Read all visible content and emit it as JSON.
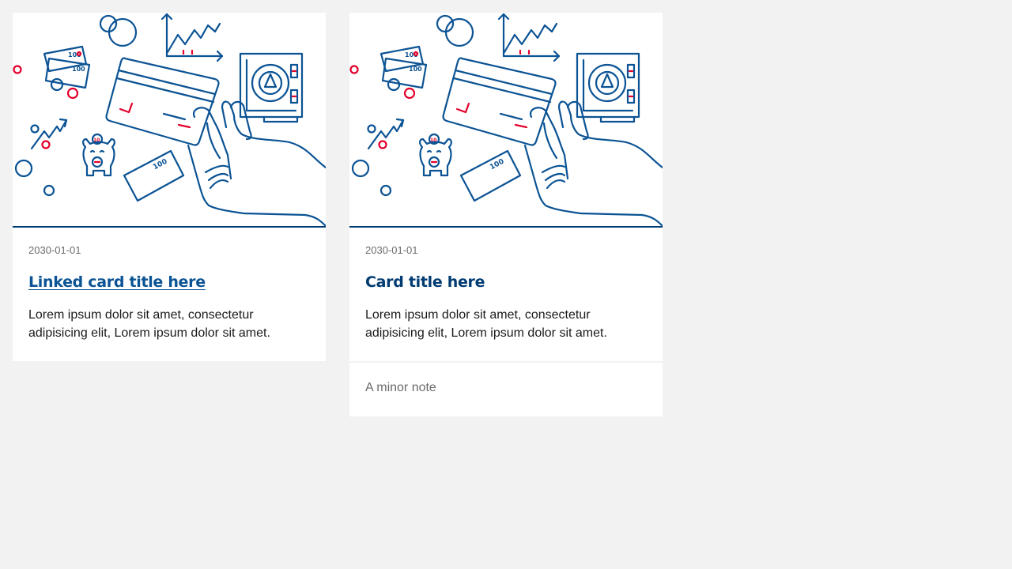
{
  "cards": [
    {
      "date": "2030-01-01",
      "title": "Linked card title here",
      "linked": true,
      "text": "Lorem ipsum dolor sit amet, consectetur adipisicing elit, Lorem ipsum dolor sit amet."
    },
    {
      "date": "2030-01-01",
      "title": "Card title here",
      "linked": false,
      "text": "Lorem ipsum dolor sit amet, consectetur adipisicing elit, Lorem ipsum dolor sit amet.",
      "footer": "A minor note"
    }
  ],
  "illustration": {
    "icons": [
      "coins-icon",
      "banknote-icon",
      "chart-icon",
      "credit-card-icon",
      "hand-icon",
      "safe-icon",
      "piggy-bank-icon",
      "trend-arrow-icon"
    ],
    "banknote_label": "100",
    "colors": {
      "line": "#0b5394",
      "accent": "#e4002b",
      "rule": "#003b71"
    }
  }
}
